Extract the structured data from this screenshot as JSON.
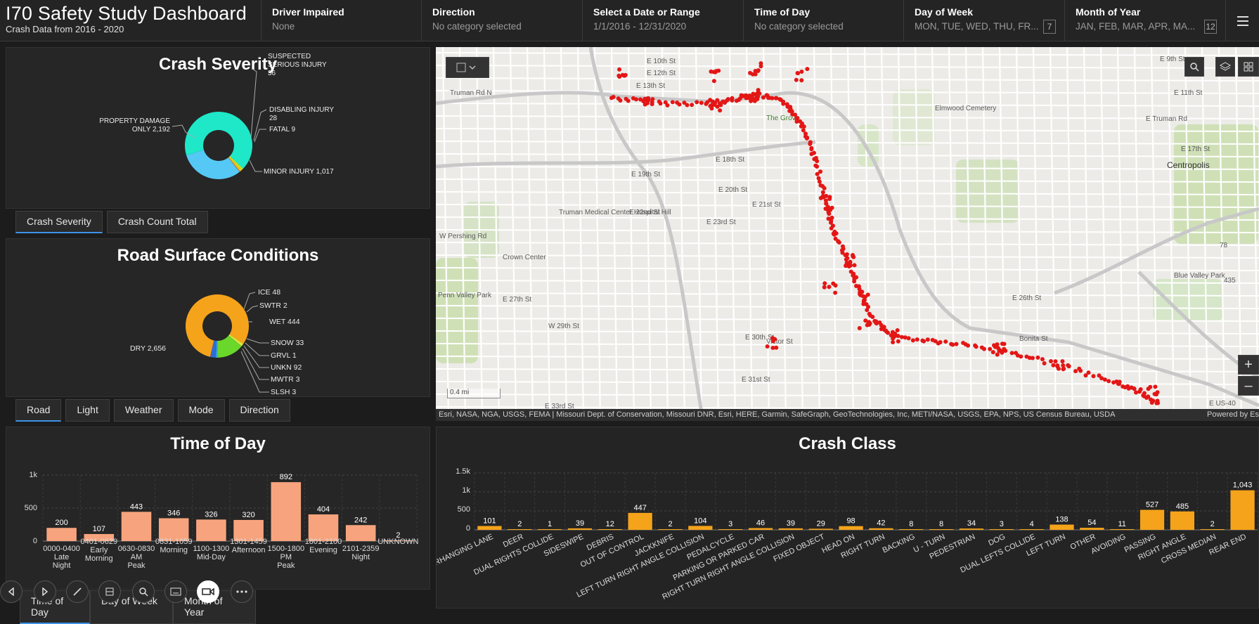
{
  "header": {
    "title": "I70 Safety Study Dashboard",
    "subtitle": "Crash Data from 2016 - 2020"
  },
  "filters": [
    {
      "label": "Driver Impaired",
      "value": "None"
    },
    {
      "label": "Direction",
      "value": "No category selected"
    },
    {
      "label": "Select a Date or Range",
      "value": "1/1/2016 - 12/31/2020"
    },
    {
      "label": "Time of Day",
      "value": "No category selected"
    },
    {
      "label": "Day of Week",
      "value": "MON, TUE, WED, THU, FR...",
      "count": "7"
    },
    {
      "label": "Month of Year",
      "value": "JAN, FEB, MAR, APR, MA...",
      "count": "12"
    }
  ],
  "crash_severity": {
    "title": "Crash Severity",
    "tabs": [
      "Crash Severity",
      "Crash Count Total"
    ],
    "labels": {
      "property_damage": [
        "PROPERTY DAMAGE",
        "ONLY 2,192"
      ],
      "suspected": [
        "SUSPECTED",
        "SERIOUS INJURY",
        "36"
      ],
      "disabling": [
        "DISABLING INJURY",
        "28"
      ],
      "fatal": "FATAL 9",
      "minor": "MINOR INJURY 1,017"
    }
  },
  "road_surface": {
    "title": "Road Surface Conditions",
    "tabs": [
      "Road",
      "Light",
      "Weather",
      "Mode",
      "Direction"
    ],
    "labels": {
      "dry": "DRY 2,656",
      "ice": "ICE 48",
      "swtr": "SWTR 2",
      "wet": "WET 444",
      "snow": "SNOW 33",
      "grvl": "GRVL 1",
      "unkn": "UNKN 92",
      "mwtr": "MWTR 3",
      "slsh": "SLSH 3"
    }
  },
  "time_of_day": {
    "title": "Time of Day",
    "tabs": [
      "Time of Day",
      "Day of Week",
      "Month of Year"
    ],
    "yticks": [
      "1k",
      "500",
      "0"
    ]
  },
  "crash_class": {
    "title": "Crash Class",
    "yticks": [
      "1.5k",
      "1k",
      "500",
      "0"
    ]
  },
  "map": {
    "attribution": "Esri, NASA, NGA, USGS, FEMA | Missouri Dept. of Conservation, Missouri DNR, Esri, HERE, Garmin, SafeGraph, GeoTechnologies, Inc, METI/NASA, USGS, EPA, NPS, US Census Bureau, USDA",
    "powered": "Powered by Es",
    "scale": "0.4 mi",
    "places": [
      {
        "name": "E 10th St"
      },
      {
        "name": "E 12th St"
      },
      {
        "name": "E 13th St"
      },
      {
        "name": "Truman Rd N"
      },
      {
        "name": "The Grove"
      },
      {
        "name": "Elmwood Cemetery"
      },
      {
        "name": "Centropolis"
      },
      {
        "name": "E 18th St"
      },
      {
        "name": "E 19th St"
      },
      {
        "name": "E 20th St"
      },
      {
        "name": "E 21st St"
      },
      {
        "name": "E 22nd St"
      },
      {
        "name": "E 23rd St"
      },
      {
        "name": "Truman Medical Center Hospital Hill"
      },
      {
        "name": "W Pershing Rd"
      },
      {
        "name": "Crown Center"
      },
      {
        "name": "E 27th St"
      },
      {
        "name": "Penn Valley Park"
      },
      {
        "name": "W 29th St"
      },
      {
        "name": "E 30th St"
      },
      {
        "name": "E 31st St"
      },
      {
        "name": "E 33rd St"
      },
      {
        "name": "Victor St"
      },
      {
        "name": "Blue Valley Park"
      },
      {
        "name": "E 26th St"
      },
      {
        "name": "Bonita St"
      },
      {
        "name": "E Truman Rd"
      },
      {
        "name": "E 17th St"
      },
      {
        "name": "E 11th St"
      },
      {
        "name": "E 9th St"
      },
      {
        "name": "E US-40"
      },
      {
        "name": "78"
      },
      {
        "name": "435"
      }
    ]
  },
  "chart_data": [
    {
      "type": "pie",
      "title": "Crash Severity",
      "categories": [
        "PROPERTY DAMAGE ONLY",
        "SUSPECTED SERIOUS INJURY",
        "DISABLING INJURY",
        "FATAL",
        "MINOR INJURY"
      ],
      "values": [
        2192,
        36,
        28,
        9,
        1017
      ],
      "colors": [
        "#1ee8c8",
        "#c8e020",
        "#f5c518",
        "#e8501e",
        "#55c8f5"
      ]
    },
    {
      "type": "pie",
      "title": "Road Surface Conditions",
      "categories": [
        "DRY",
        "ICE",
        "SWTR",
        "WET",
        "SNOW",
        "GRVL",
        "UNKN",
        "MWTR",
        "SLSH"
      ],
      "values": [
        2656,
        48,
        2,
        444,
        33,
        1,
        92,
        3,
        3
      ],
      "colors": [
        "#f5a31a",
        "#d8e83a",
        "#c0c0c0",
        "#6ad82a",
        "#3ab0e8",
        "#888888",
        "#2a6fd8",
        "#9a5ad8",
        "#d85a9a"
      ]
    },
    {
      "type": "bar",
      "title": "Time of Day",
      "categories": [
        "0000-0400 Late Night",
        "0401-0629 Early Morning",
        "0630-0830 AM Peak",
        "0831-1059 Morning",
        "1100-1300 Mid-Day",
        "1301-1459 Afternoon",
        "1500-1800 PM Peak",
        "1801-2100 Evening",
        "2101-2359 Night",
        "UNKNOWN"
      ],
      "values": [
        200,
        107,
        443,
        346,
        326,
        320,
        892,
        404,
        242,
        2
      ],
      "ylim": [
        0,
        1000
      ],
      "color": "#f7a47e"
    },
    {
      "type": "bar",
      "title": "Crash Class",
      "categories": [
        "OVERHANGING LANE",
        "DEER",
        "DUAL RIGHTS COLLIDE",
        "SIDESWIPE",
        "DEBRIS",
        "OUT OF CONTROL",
        "JACKKNIFE",
        "LEFT TURN RIGHT ANGLE COLLISION",
        "PEDALCYCLE",
        "PARKING OR PARKED CAR",
        "RIGHT TURN RIGHT ANGLE COLLISION",
        "FIXED OBJECT",
        "HEAD ON",
        "RIGHT TURN",
        "BACKING",
        "U - TURN",
        "PEDESTRIAN",
        "DOG",
        "DUAL LEFTS COLLIDE",
        "LEFT TURN",
        "OTHER",
        "AVOIDING",
        "PASSING",
        "RIGHT ANGLE",
        "CROSS MEDIAN",
        "REAR END"
      ],
      "values": [
        101,
        2,
        1,
        39,
        12,
        447,
        2,
        104,
        3,
        46,
        39,
        29,
        98,
        42,
        8,
        8,
        34,
        3,
        4,
        138,
        54,
        11,
        527,
        485,
        2,
        1043
      ],
      "ylim": [
        0,
        1500
      ],
      "color": "#f5a31a"
    }
  ]
}
